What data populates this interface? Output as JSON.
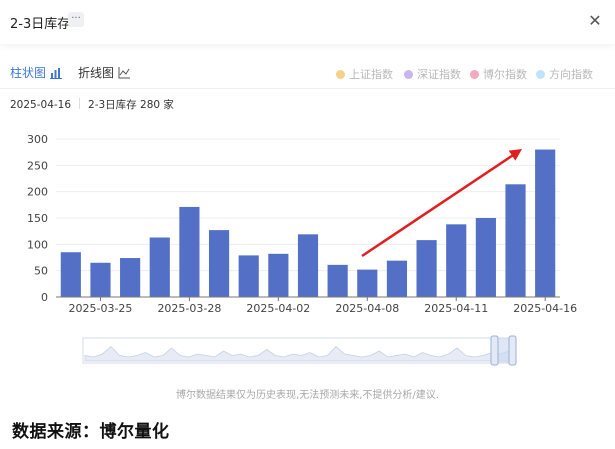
{
  "header": {
    "title": "2-3日库存",
    "more_label": "···",
    "close_label": "✕"
  },
  "tabs": {
    "bar_label": "柱状图",
    "line_label": "折线图"
  },
  "legend": [
    {
      "label": "上证指数",
      "color": "#f5d28c"
    },
    {
      "label": "深证指数",
      "color": "#c9b4f0"
    },
    {
      "label": "博尔指数",
      "color": "#f3a9be"
    },
    {
      "label": "方向指数",
      "color": "#bfe3f7"
    }
  ],
  "info": {
    "date": "2025-04-16",
    "summary": "2-3日库存 280 家"
  },
  "chart_data": {
    "type": "bar",
    "bar_color": "#5470c6",
    "ylim": [
      0,
      300
    ],
    "y_ticks": [
      0,
      50,
      100,
      150,
      200,
      250,
      300
    ],
    "values": [
      85,
      65,
      74,
      113,
      171,
      127,
      79,
      82,
      119,
      61,
      52,
      69,
      108,
      138,
      150,
      214,
      280
    ],
    "tick_labels": [
      {
        "index": 1,
        "label": "2025-03-25"
      },
      {
        "index": 4,
        "label": "2025-03-28"
      },
      {
        "index": 7,
        "label": "2025-04-02"
      },
      {
        "index": 10,
        "label": "2025-04-08"
      },
      {
        "index": 13,
        "label": "2025-04-11"
      },
      {
        "index": 16,
        "label": "2025-04-16"
      }
    ],
    "arrow_color": "#e02020"
  },
  "footer": {
    "disclaimer": "博尔数据结果仅为历史表现,无法预测未来,不提供分析/建议.",
    "source": "数据来源：博尔量化"
  }
}
